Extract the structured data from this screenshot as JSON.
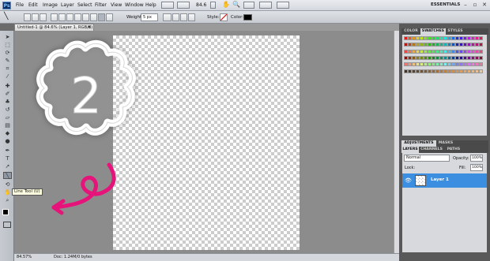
{
  "app": {
    "logo": "Ps"
  },
  "menu": [
    "File",
    "Edit",
    "Image",
    "Layer",
    "Select",
    "Filter",
    "View",
    "Window",
    "Help"
  ],
  "menu_right": {
    "zoom_value": "84.6",
    "workspace": "ESSENTIALS"
  },
  "options": {
    "weight_label": "Weight:",
    "weight_value": "5 px",
    "style_label": "Style:",
    "color_label": "Color:",
    "color_value": "#000000"
  },
  "document_tab": {
    "title": "Untitled-1 @ 84.6% (Layer 1, RGB/8)"
  },
  "tooltip": {
    "text": "Line Tool (U)"
  },
  "status": {
    "zoom": "84.57%",
    "doc": "Doc: 1.24M/0 bytes"
  },
  "panels": {
    "top_tabs": [
      "COLOR",
      "SWATCHES",
      "STYLES"
    ],
    "top_active": 1,
    "mid_tabs": [
      "ADJUSTMENTS",
      "MASKS"
    ],
    "layer_tabs": [
      "LAYERS",
      "CHANNELS",
      "PATHS"
    ],
    "blend_mode": "Normal",
    "opacity_label": "Opacity:",
    "opacity_value": "100%",
    "lock_label": "Lock:",
    "fill_label": "Fill:",
    "fill_value": "100%",
    "layer_name": "Layer 1"
  },
  "artwork": {
    "badge_text": "2"
  },
  "colors": {
    "accent_pink": "#e6137a",
    "layer_selected": "#3c8fe0"
  }
}
